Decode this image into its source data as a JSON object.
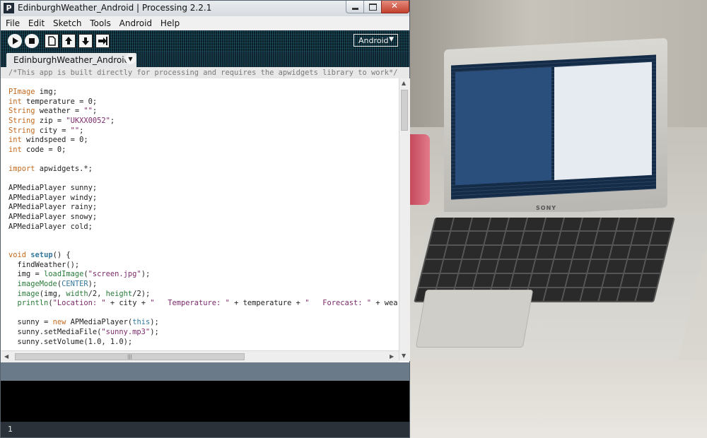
{
  "window": {
    "title": "EdinburghWeather_Android | Processing 2.2.1",
    "app_icon": "P"
  },
  "menu": [
    "File",
    "Edit",
    "Sketch",
    "Tools",
    "Android",
    "Help"
  ],
  "toolbar": {
    "buttons": [
      "run-icon",
      "stop-icon",
      "new-icon",
      "open-icon",
      "save-icon",
      "export-icon"
    ],
    "mode": "Android"
  },
  "tab": {
    "label": "EdinburghWeather_Android"
  },
  "code_lines": [
    "/*This app is built directly for processing and requires the apwidgets library to work*/",
    "",
    "PImage img;",
    "int temperature = 0;",
    "String weather = \"\";",
    "String zip = \"UKXX0052\";",
    "String city = \"\";",
    "int windspeed = 0;",
    "int code = 0;",
    "",
    "import apwidgets.*;",
    "",
    "APMediaPlayer sunny;",
    "APMediaPlayer windy;",
    "APMediaPlayer rainy;",
    "APMediaPlayer snowy;",
    "APMediaPlayer cold;",
    "",
    "",
    "void setup() {",
    "  findWeather();",
    "  img = loadImage(\"screen.jpg\");",
    "  imageMode(CENTER);",
    "  image(img, width/2, height/2);",
    "  println(\"Location: \" + city + \"   Temperature: \" + temperature + \"   Forecast: \" + weather",
    "",
    "  sunny = new APMediaPlayer(this);",
    "  sunny.setMediaFile(\"sunny.mp3\");",
    "  sunny.setVolume(1.0, 1.0);"
  ],
  "status_line": "1",
  "photo": {
    "brand": "SONY"
  },
  "colors": {
    "keyword": "#c46a1e",
    "function": "#2a7a3a",
    "string": "#7a2a6a",
    "comment": "#7a7a7a",
    "console": "#000000"
  }
}
